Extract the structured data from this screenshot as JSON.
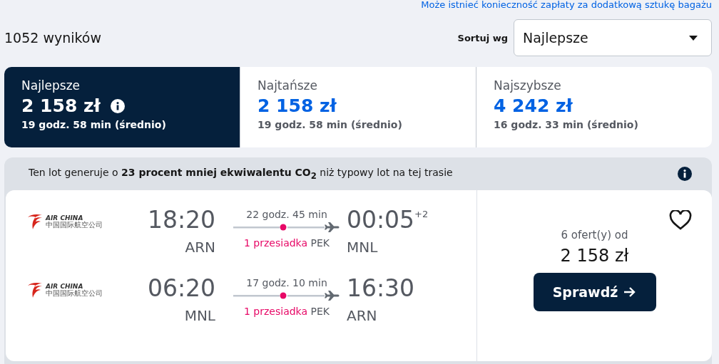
{
  "baggage_notice": "Może istnieć konieczność zapłaty za dodatkową sztukę bagażu",
  "results_count": "1052 wyników",
  "sort": {
    "label": "Sortuj wg",
    "value": "Najlepsze"
  },
  "sort_tabs": [
    {
      "label": "Najlepsze",
      "price": "2 158 zł",
      "duration": "19 godz. 58 min (średnio)",
      "selected": true,
      "info": true
    },
    {
      "label": "Najtańsze",
      "price": "2 158 zł",
      "duration": "19 godz. 58 min (średnio)",
      "selected": false,
      "info": false
    },
    {
      "label": "Najszybsze",
      "price": "4 242 zł",
      "duration": "16 godz. 33 min (średnio)",
      "selected": false,
      "info": false
    }
  ],
  "eco_banner": "Ten lot generuje o **23 procent mniej ekwiwalentu CO$_{2}$** niż typowy lot na tej trasie",
  "flight_card": {
    "legs": [
      {
        "airline": "AIR CHINA",
        "airline_sub": "中国国际航空公司",
        "depart_time": "18:20",
        "depart_airport": "ARN",
        "duration": "22 godz. 45 min",
        "stops": "1 przesiadka",
        "stop_airport": "PEK",
        "arrive_time": "00:05",
        "day_offset": "+2",
        "arrive_airport": "MNL"
      },
      {
        "airline": "AIR CHINA",
        "airline_sub": "中国国际航空公司",
        "depart_time": "06:20",
        "depart_airport": "MNL",
        "duration": "17 godz. 10 min",
        "stops": "1 przesiadka",
        "stop_airport": "PEK",
        "arrive_time": "16:30",
        "arrive_airport": "ARN"
      }
    ],
    "offers": "6 ofert(y) od",
    "price": "2 158 zł",
    "button": "Sprawdź",
    "favorite": false
  }
}
